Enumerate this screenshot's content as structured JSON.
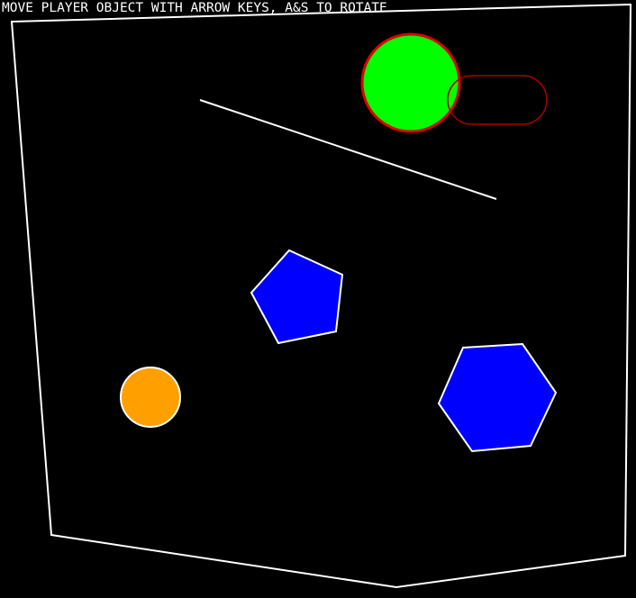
{
  "hud": {
    "instructions": "MOVE PLAYER OBJECT WITH ARROW KEYS, A&S TO ROTATE"
  },
  "colors": {
    "background": "#000000",
    "outline": "#ffffff",
    "player_fill": "#00ff00",
    "player_stroke": "#dd0000",
    "capsule_stroke": "#aa0000",
    "polygon_fill": "#0000ff",
    "ball_fill": "#ffa000"
  },
  "objects": [
    {
      "name": "arena-boundary",
      "kind": "boundary"
    },
    {
      "name": "static-line",
      "kind": "segment"
    },
    {
      "name": "player-circle",
      "kind": "circle",
      "controlled": true
    },
    {
      "name": "capsule-outline",
      "kind": "capsule"
    },
    {
      "name": "blue-pentagon",
      "kind": "polygon",
      "sides": 5
    },
    {
      "name": "blue-hexagon",
      "kind": "polygon",
      "sides": 6
    },
    {
      "name": "orange-ball",
      "kind": "circle"
    }
  ]
}
